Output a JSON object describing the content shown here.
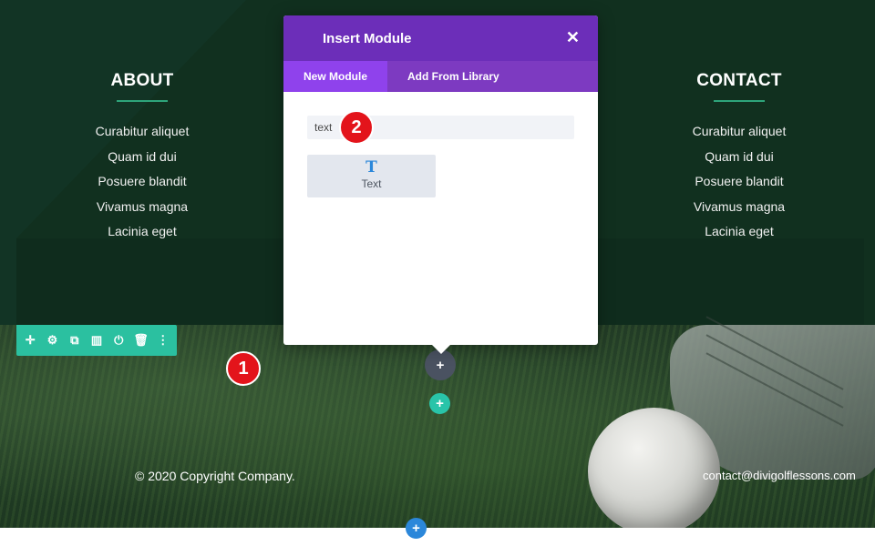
{
  "footer_columns": {
    "about": {
      "heading": "ABOUT",
      "links": [
        "Curabitur aliquet",
        "Quam id dui",
        "Posuere blandit",
        "Vivamus magna",
        "Lacinia eget"
      ]
    },
    "contact": {
      "heading": "CONTACT",
      "links": [
        "Curabitur aliquet",
        "Quam id dui",
        "Posuere blandit",
        "Vivamus magna",
        "Lacinia eget"
      ]
    }
  },
  "footer_bottom": {
    "copyright": "© 2020 Copyright Company.",
    "email": "contact@divigolflessons.com"
  },
  "modal": {
    "title": "Insert Module",
    "close_glyph": "✕",
    "tabs": [
      {
        "label": "New Module",
        "active": true
      },
      {
        "label": "Add From Library",
        "active": false
      }
    ],
    "search_value": "text",
    "results": [
      {
        "icon_glyph": "T",
        "label": "Text"
      }
    ]
  },
  "row_toolbar": {
    "icons": [
      {
        "name": "move-icon",
        "glyph": "✛"
      },
      {
        "name": "settings-icon",
        "glyph": "⚙"
      },
      {
        "name": "duplicate-icon",
        "glyph": "⧉"
      },
      {
        "name": "columns-icon",
        "glyph": "▥"
      },
      {
        "name": "power-icon",
        "glyph": "⏻"
      },
      {
        "name": "trash-icon",
        "glyph": "🗑"
      },
      {
        "name": "more-icon",
        "glyph": "⋮"
      }
    ]
  },
  "badges": {
    "one": "1",
    "two": "2"
  },
  "plus_glyph": "+",
  "colors": {
    "modal_header": "#6c2eb9",
    "active_tab": "#8f42ec",
    "toolbar": "#2bc0a0",
    "accent_underline": "#2ea47a",
    "badge_red": "#e3141b",
    "add_row_blue": "#2b87da"
  }
}
